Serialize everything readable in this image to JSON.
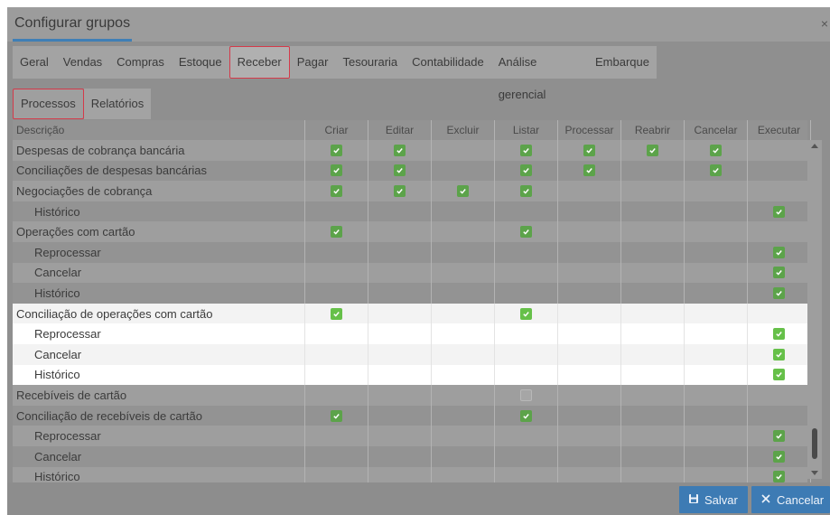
{
  "dialog": {
    "title": "Configurar grupos",
    "close_label": "×"
  },
  "tabs": [
    {
      "label": "Geral",
      "active": false
    },
    {
      "label": "Vendas",
      "active": false
    },
    {
      "label": "Compras",
      "active": false
    },
    {
      "label": "Estoque",
      "active": false
    },
    {
      "label": "Receber",
      "active": true
    },
    {
      "label": "Pagar",
      "active": false
    },
    {
      "label": "Tesouraria",
      "active": false
    },
    {
      "label": "Contabilidade",
      "active": false
    },
    {
      "label": "Análise gerencial",
      "active": false
    },
    {
      "label": "Embarque",
      "active": false
    }
  ],
  "subtabs": [
    {
      "label": "Processos",
      "active": true
    },
    {
      "label": "Relatórios",
      "active": false
    }
  ],
  "columns": [
    "Descrição",
    "Criar",
    "Editar",
    "Excluir",
    "Listar",
    "Processar",
    "Reabrir",
    "Cancelar",
    "Executar"
  ],
  "rows": [
    {
      "label": "Despesas de cobrança bancária",
      "indent": false,
      "band": "band-dark",
      "checks": [
        1,
        1,
        0,
        1,
        1,
        1,
        1,
        0
      ]
    },
    {
      "label": "Conciliações de despesas bancárias",
      "indent": false,
      "band": "band-light",
      "checks": [
        1,
        1,
        0,
        1,
        1,
        0,
        1,
        0
      ]
    },
    {
      "label": "Negociações de cobrança",
      "indent": false,
      "band": "band-dark",
      "checks": [
        1,
        1,
        1,
        1,
        0,
        0,
        0,
        0
      ]
    },
    {
      "label": "Histórico",
      "indent": true,
      "band": "band-light",
      "checks": [
        0,
        0,
        0,
        0,
        0,
        0,
        0,
        1
      ]
    },
    {
      "label": "Operações com cartão",
      "indent": false,
      "band": "band-dark",
      "checks": [
        1,
        0,
        0,
        1,
        0,
        0,
        0,
        0
      ]
    },
    {
      "label": "Reprocessar",
      "indent": true,
      "band": "band-light",
      "checks": [
        0,
        0,
        0,
        0,
        0,
        0,
        0,
        1
      ]
    },
    {
      "label": "Cancelar",
      "indent": true,
      "band": "band-dark",
      "checks": [
        0,
        0,
        0,
        0,
        0,
        0,
        0,
        1
      ]
    },
    {
      "label": "Histórico",
      "indent": true,
      "band": "band-light",
      "checks": [
        0,
        0,
        0,
        0,
        0,
        0,
        0,
        1
      ]
    },
    {
      "label": "Conciliação de operações com cartão",
      "indent": false,
      "band": "white2",
      "checks": [
        1,
        0,
        0,
        1,
        0,
        0,
        0,
        0
      ]
    },
    {
      "label": "Reprocessar",
      "indent": true,
      "band": "white",
      "checks": [
        0,
        0,
        0,
        0,
        0,
        0,
        0,
        1
      ]
    },
    {
      "label": "Cancelar",
      "indent": true,
      "band": "white2",
      "checks": [
        0,
        0,
        0,
        0,
        0,
        0,
        0,
        1
      ]
    },
    {
      "label": "Histórico",
      "indent": true,
      "band": "white",
      "checks": [
        0,
        0,
        0,
        0,
        0,
        0,
        0,
        1
      ]
    },
    {
      "label": "Recebíveis de cartão",
      "indent": false,
      "band": "band-dark",
      "checks": [
        0,
        0,
        0,
        2,
        0,
        0,
        0,
        0
      ]
    },
    {
      "label": "Conciliação de recebíveis de cartão",
      "indent": false,
      "band": "band-light",
      "checks": [
        1,
        0,
        0,
        1,
        0,
        0,
        0,
        0
      ]
    },
    {
      "label": "Reprocessar",
      "indent": true,
      "band": "band-dark",
      "checks": [
        0,
        0,
        0,
        0,
        0,
        0,
        0,
        1
      ]
    },
    {
      "label": "Cancelar",
      "indent": true,
      "band": "band-light",
      "checks": [
        0,
        0,
        0,
        0,
        0,
        0,
        0,
        1
      ]
    },
    {
      "label": "Histórico",
      "indent": true,
      "band": "band-dark",
      "checks": [
        0,
        0,
        0,
        0,
        0,
        0,
        0,
        1
      ]
    }
  ],
  "footer": {
    "save_label": "Salvar",
    "cancel_label": "Cancelar"
  },
  "colors": {
    "accent": "#3d7bb4",
    "active_tab_border": "#d43a4a",
    "check_green": "#5ca34a"
  },
  "icons": {
    "save": "floppy-disk-icon",
    "cancel": "x-icon",
    "check": "checkmark-icon"
  }
}
